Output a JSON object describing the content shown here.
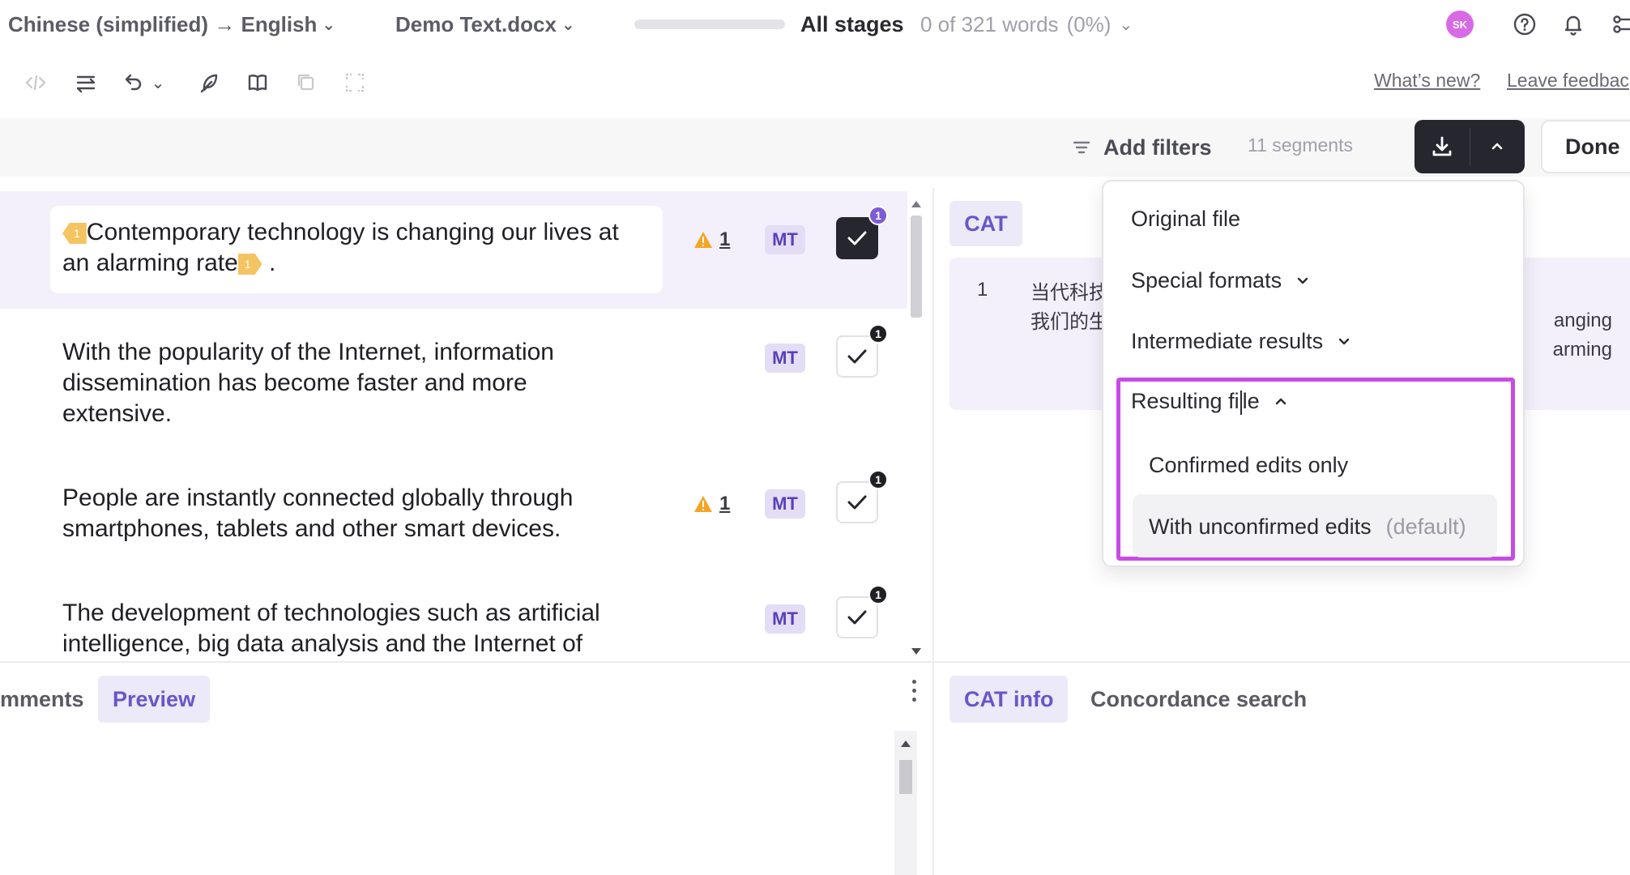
{
  "topbar": {
    "language_pair": "Chinese (simplified) → English",
    "document": "Demo Text.docx",
    "progress_percent": 0,
    "stages": "All stages",
    "word_count": "0 of 321 words",
    "word_percent": "(0%)",
    "avatar_initials": "SK"
  },
  "toolbar": {
    "whats_new": "What’s new?",
    "leave_feedback": "Leave feedbac"
  },
  "filterbar": {
    "add_filters": "Add filters",
    "segments": "11 segments",
    "done": "Done"
  },
  "segments": [
    {
      "text_main": "Contemporary technology is changing our lives at",
      "text_cont": "an alarming rate",
      "tail": ".",
      "tag_label": "1",
      "warnings": "1",
      "badge": "MT",
      "check_count": "1"
    },
    {
      "text": "With the popularity of the Internet, information dissemination has become faster and more extensive.",
      "badge": "MT",
      "check_count": "1"
    },
    {
      "text": "People are instantly connected globally through smartphones, tablets and other smart devices.",
      "warnings": "1",
      "badge": "MT",
      "check_count": "1"
    },
    {
      "text": "The development of technologies such as artificial intelligence, big data analysis and the Internet of",
      "badge": "MT",
      "check_count": "1"
    }
  ],
  "cat": {
    "tab": "CAT",
    "number": "1",
    "source_line1": "当代科技",
    "source_line2": "我们的生",
    "target_line1": "anging",
    "target_line2": "arming"
  },
  "download_menu": {
    "original_file": "Original file",
    "special_formats": "Special formats",
    "intermediate_results": "Intermediate results",
    "resulting_file_a": "Resulting fi",
    "resulting_file_b": "le",
    "confirmed_only": "Confirmed edits only",
    "with_unconfirmed": "With unconfirmed edits",
    "default_label": "(default)"
  },
  "bottom_left": {
    "comments_tab": "mments",
    "preview_tab": "Preview"
  },
  "bottom_right": {
    "cat_info_tab": "CAT info",
    "concordance_tab": "Concordance search"
  },
  "colors": {
    "accent": "#7c5cd6",
    "highlight_border": "#c94be6",
    "dark_button": "#26262f",
    "warning": "#f5a524",
    "tag": "#f5c462"
  }
}
